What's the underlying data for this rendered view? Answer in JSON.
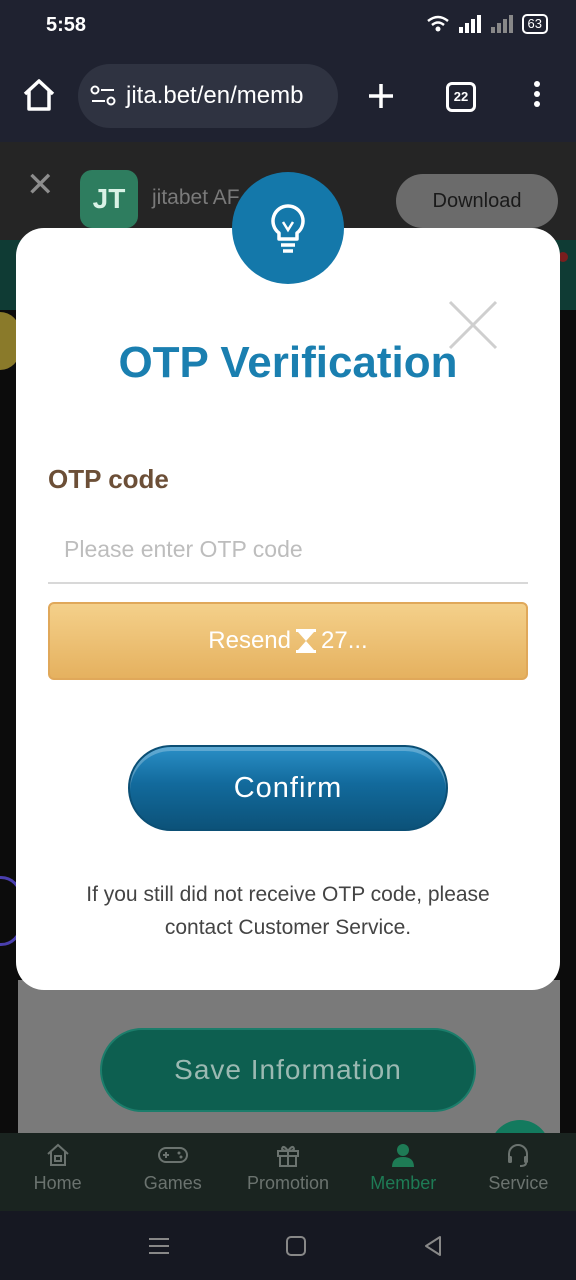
{
  "status_bar": {
    "time": "5:58",
    "battery": "63"
  },
  "browser": {
    "url": "jita.bet/en/memb",
    "tab_count": "22"
  },
  "app_banner": {
    "logo_text": "JT",
    "app_name": "jitabet AF",
    "download_label": "Download"
  },
  "modal": {
    "title": "OTP Verification",
    "field_label": "OTP code",
    "placeholder": "Please enter OTP code",
    "resend_label": "Resend",
    "countdown": "27...",
    "confirm_label": "Confirm",
    "help_text": "If you still did not receive OTP code, please contact Customer Service."
  },
  "page": {
    "save_label": "Save Information"
  },
  "bottom_nav": [
    {
      "label": "Home",
      "icon": "home-icon"
    },
    {
      "label": "Games",
      "icon": "gamepad-icon"
    },
    {
      "label": "Promotion",
      "icon": "gift-icon"
    },
    {
      "label": "Member",
      "icon": "member-icon",
      "active": true
    },
    {
      "label": "Service",
      "icon": "headset-icon"
    }
  ],
  "colors": {
    "accent_blue": "#1a7fb0",
    "resend_gold": "#e5b15f",
    "member_green": "#1e7b55"
  }
}
